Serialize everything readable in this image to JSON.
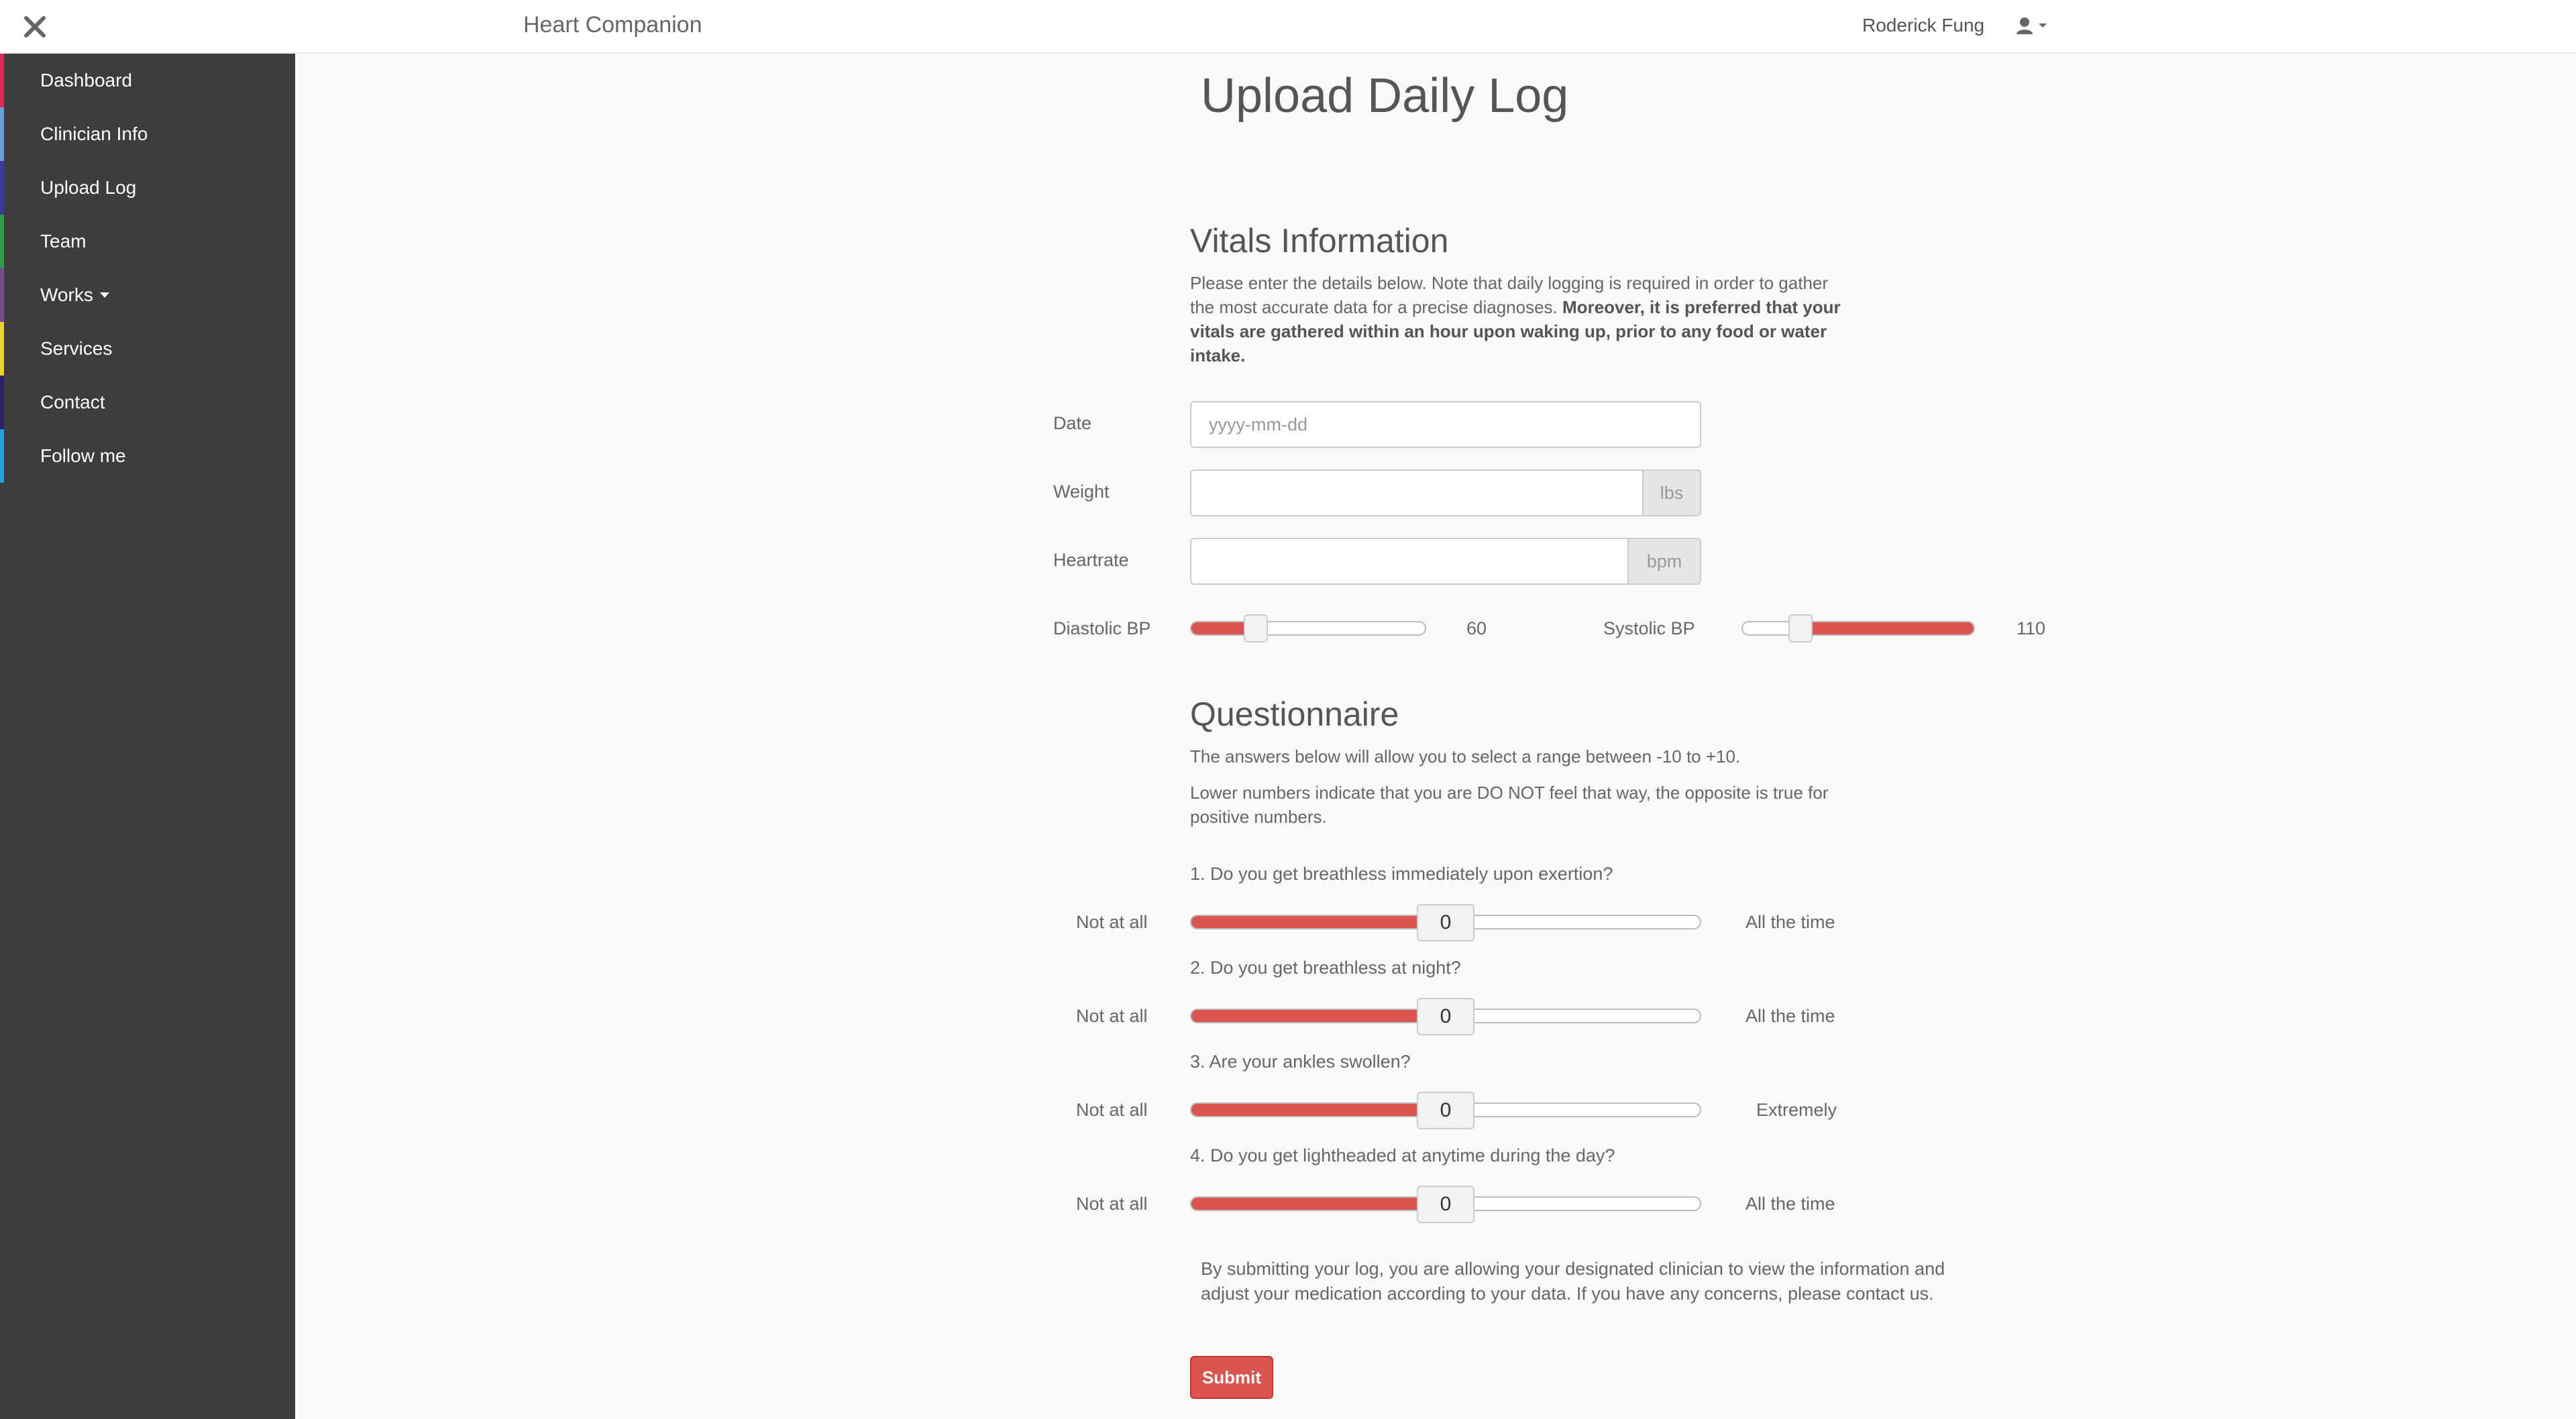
{
  "header": {
    "close_icon": "close-icon",
    "brand": "Heart Companion",
    "username": "Roderick Fung",
    "user_icon": "user-icon"
  },
  "sidebar": {
    "items": [
      {
        "label": "Dashboard",
        "color": "#e0245e"
      },
      {
        "label": "Clinician Info",
        "color": "#6a9fd8"
      },
      {
        "label": "Upload Log",
        "color": "#3b3b9e"
      },
      {
        "label": "Team",
        "color": "#2e9a4a"
      },
      {
        "label": "Works",
        "color": "#7a4a8c",
        "has_dropdown": true
      },
      {
        "label": "Services",
        "color": "#e8d52a"
      },
      {
        "label": "Contact",
        "color": "#2b2464"
      },
      {
        "label": "Follow me",
        "color": "#22a3d9"
      }
    ]
  },
  "page": {
    "title": "Upload Daily Log"
  },
  "vitals": {
    "title": "Vitals Information",
    "intro_plain": "Please enter the details below. Note that daily logging is required in order to gather the most accurate data for a precise diagnoses. ",
    "intro_bold": "Moreover, it is preferred that your vitals are gathered within an hour upon waking up, prior to any food or water intake.",
    "date_label": "Date",
    "date_placeholder": "yyyy-mm-dd",
    "weight_label": "Weight",
    "weight_unit": "lbs",
    "heartrate_label": "Heartrate",
    "heartrate_unit": "bpm",
    "diastolic_label": "Diastolic BP",
    "diastolic_value": "60",
    "diastolic_fraction": 0.25,
    "systolic_label": "Systolic BP",
    "systolic_value": "110",
    "systolic_fraction": 0.22
  },
  "questionnaire": {
    "title": "Questionnaire",
    "intro_1": "The answers below will allow you to select a range between -10 to +10.",
    "intro_2": "Lower numbers indicate that you are DO NOT feel that way, the opposite is true for positive numbers.",
    "questions": [
      {
        "text": "1. Do you get breathless immediately upon exertion?",
        "low": "Not at all",
        "high": "All the time",
        "value": "0",
        "fraction": 0.5
      },
      {
        "text": "2. Do you get breathless at night?",
        "low": "Not at all",
        "high": "All the time",
        "value": "0",
        "fraction": 0.5
      },
      {
        "text": "3. Are your ankles swollen?",
        "low": "Not at all",
        "high": "Extremely",
        "value": "0",
        "fraction": 0.5
      },
      {
        "text": "4. Do you get lightheaded at anytime during the day?",
        "low": "Not at all",
        "high": "All the time",
        "value": "0",
        "fraction": 0.5
      }
    ]
  },
  "consent": {
    "text": "By submitting your log, you are allowing your designated clinician to view the information and adjust your medication according to your data. If you have any concerns, please contact us."
  },
  "actions": {
    "submit_label": "Submit"
  },
  "colors": {
    "accent": "#d9534f",
    "sidebar_bg": "#3d3d3d"
  }
}
